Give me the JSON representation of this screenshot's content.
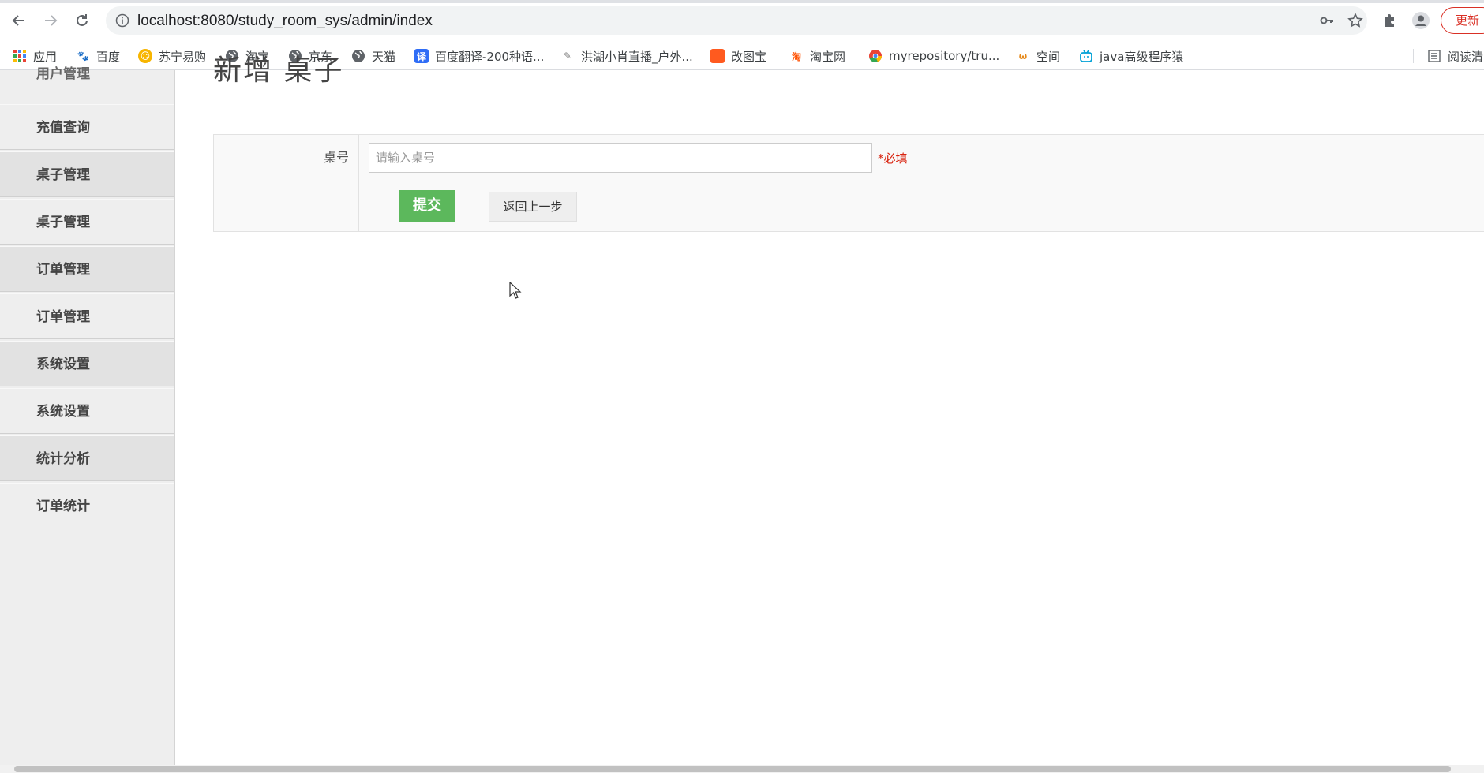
{
  "browser": {
    "url": "localhost:8080/study_room_sys/admin/index",
    "update_label": "更新",
    "bookmarks": [
      {
        "label": "应用",
        "icon": "apps-grid-icon"
      },
      {
        "label": "百度",
        "icon": "baidu-paw-icon"
      },
      {
        "label": "苏宁易购",
        "icon": "suning-lion-icon"
      },
      {
        "label": "淘宝",
        "icon": "globe-icon"
      },
      {
        "label": "京东",
        "icon": "globe-icon"
      },
      {
        "label": "天猫",
        "icon": "globe-icon"
      },
      {
        "label": "百度翻译-200种语...",
        "icon": "translate-icon"
      },
      {
        "label": "洪湖小肖直播_户外...",
        "icon": "feather-icon"
      },
      {
        "label": "改图宝",
        "icon": "image-tool-icon"
      },
      {
        "label": "淘宝网",
        "icon": "taobao-icon"
      },
      {
        "label": "myrepository/tru...",
        "icon": "chrome-icon"
      },
      {
        "label": "空间",
        "icon": "qzone-icon"
      },
      {
        "label": "java高级程序猿",
        "icon": "bilibili-icon"
      }
    ],
    "reading_list_label": "阅读清"
  },
  "sidebar": {
    "cut_top_label": "用户管理",
    "items": [
      {
        "label": "充值查询",
        "group": false
      },
      {
        "label": "桌子管理",
        "group": true
      },
      {
        "label": "桌子管理",
        "group": false
      },
      {
        "label": "订单管理",
        "group": true
      },
      {
        "label": "订单管理",
        "group": false
      },
      {
        "label": "系统设置",
        "group": true
      },
      {
        "label": "系统设置",
        "group": false
      },
      {
        "label": "统计分析",
        "group": true
      },
      {
        "label": "订单统计",
        "group": false
      }
    ]
  },
  "page": {
    "heading": "新增 桌子"
  },
  "form": {
    "desk_label": "桌号",
    "desk_placeholder": "请输入桌号",
    "desk_value": "",
    "required_note": "*必填",
    "submit_label": "提交",
    "back_label": "返回上一步"
  },
  "colors": {
    "submit_green": "#5cb85c",
    "required_red": "#d9230f",
    "update_red": "#d93025"
  }
}
